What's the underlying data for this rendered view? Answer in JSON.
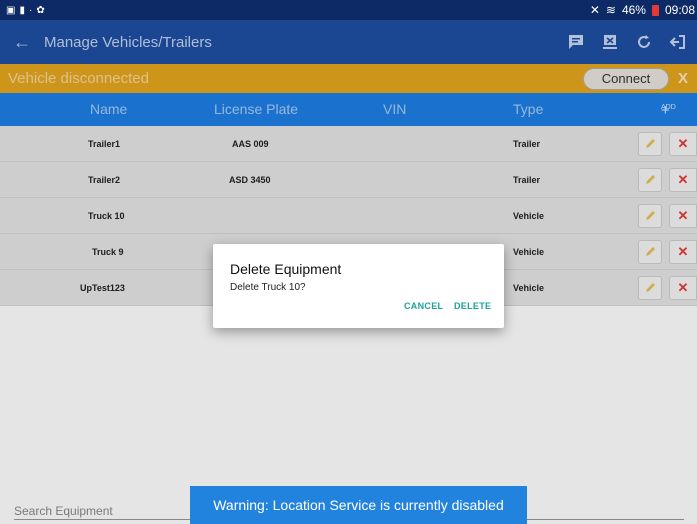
{
  "status_bar": {
    "battery": "46%",
    "time": "09:08"
  },
  "app_bar": {
    "title": "Manage Vehicles/Trailers"
  },
  "banner": {
    "message": "Vehicle disconnected",
    "connect_label": "Connect",
    "close_label": "X"
  },
  "table": {
    "headers": {
      "name": "Name",
      "license_plate": "License Plate",
      "vin": "VIN",
      "type": "Type",
      "add_symbol": "+",
      "add_label": "ADD"
    },
    "rows": [
      {
        "name": "Trailer1",
        "plate": "AAS 009",
        "vin": "",
        "type": "Trailer"
      },
      {
        "name": "Trailer2",
        "plate": "ASD 3450",
        "vin": "",
        "type": "Trailer"
      },
      {
        "name": "Truck 10",
        "plate": "",
        "vin": "",
        "type": "Vehicle"
      },
      {
        "name": "Truck 9",
        "plate": "",
        "vin": "",
        "type": "Vehicle"
      },
      {
        "name": "UpTest123",
        "plate": "",
        "vin": "",
        "type": "Vehicle"
      }
    ],
    "delete_glyph": "✕"
  },
  "dialog": {
    "title": "Delete Equipment",
    "message": "Delete Truck 10?",
    "cancel_label": "CANCEL",
    "delete_label": "DELETE"
  },
  "search": {
    "placeholder": "Search Equipment"
  },
  "toast": {
    "message": "Warning: Location Service is currently disabled"
  },
  "colors": {
    "status_bar": "#0d2a66",
    "app_bar": "#1d4fa3",
    "banner": "#e5a81f",
    "table_header": "#1f7ee6",
    "row_bg": "#e6e6e6",
    "delete_red": "#e53935",
    "edit_yellow": "#e8c25a",
    "dialog_accent": "#1aa39a",
    "toast": "#2183de"
  },
  "icons": [
    "back-arrow-icon",
    "message-icon",
    "disconnect-device-icon",
    "refresh-icon",
    "logout-icon",
    "pencil-icon",
    "delete-x-icon",
    "bluetooth-icon",
    "wifi-icon",
    "battery-icon"
  ]
}
